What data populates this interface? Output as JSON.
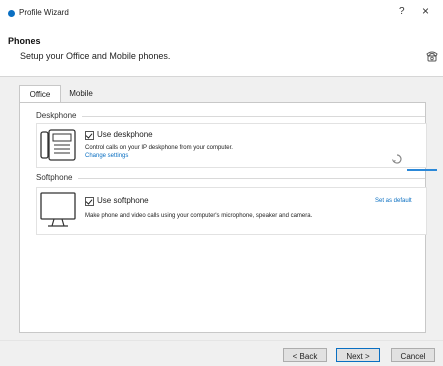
{
  "window": {
    "title": "Profile Wizard",
    "help_label": "?",
    "close_label": "×"
  },
  "header": {
    "title": "Phones",
    "subtitle": "Setup your Office and Mobile phones."
  },
  "tabs": [
    {
      "label": "Office",
      "active": true
    },
    {
      "label": "Mobile",
      "active": false
    }
  ],
  "deskphone": {
    "section_label": "Deskphone",
    "checkbox_label": "Use deskphone",
    "checked": true,
    "description": "Control calls on your IP deskphone from your computer.",
    "link": "Change settings"
  },
  "softphone": {
    "section_label": "Softphone",
    "checkbox_label": "Use softphone",
    "checked": true,
    "description": "Make phone and video calls using your computer's microphone, speaker and camera.",
    "set_default": "Set as default"
  },
  "buttons": {
    "back": "< Back",
    "next": "Next >",
    "cancel": "Cancel"
  },
  "colors": {
    "accent": "#0a6fc2",
    "background": "#f0f0f0",
    "panel": "#ffffff"
  }
}
